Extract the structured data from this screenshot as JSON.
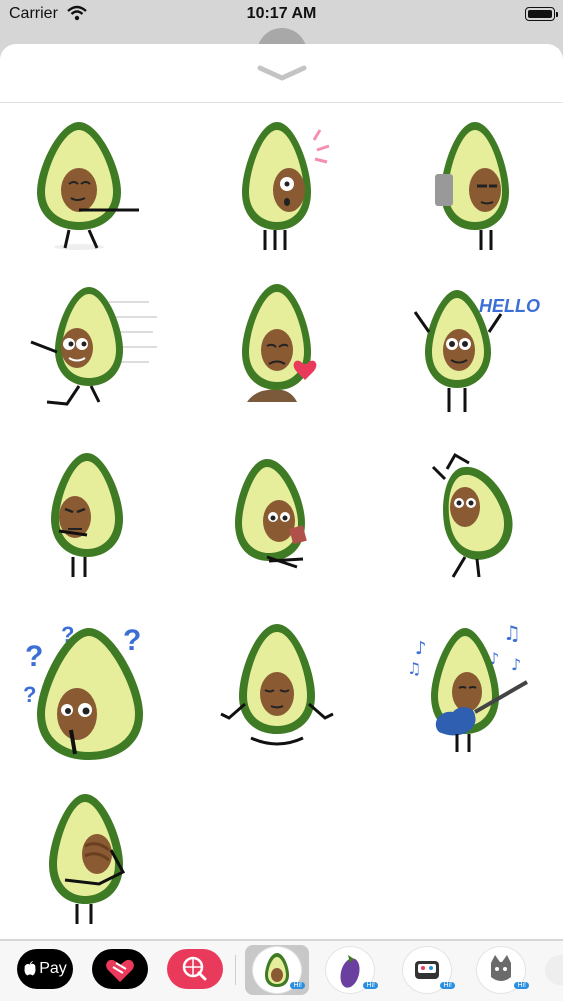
{
  "status_bar": {
    "carrier": "Carrier",
    "time": "10:17 AM",
    "battery_level": 1.0
  },
  "sheet": {
    "collapse_icon": "chevron-down-icon"
  },
  "stickers": [
    {
      "pose": "avocado-pointing"
    },
    {
      "pose": "avocado-surprised"
    },
    {
      "pose": "avocado-phone"
    },
    {
      "pose": "avocado-running"
    },
    {
      "pose": "avocado-broken-heart"
    },
    {
      "pose": "avocado-hello",
      "text": "HELLO"
    },
    {
      "pose": "avocado-angry"
    },
    {
      "pose": "avocado-reading"
    },
    {
      "pose": "avocado-stretching"
    },
    {
      "pose": "avocado-confused"
    },
    {
      "pose": "avocado-meditating"
    },
    {
      "pose": "avocado-guitar"
    },
    {
      "pose": "avocado-shy"
    }
  ],
  "tray": {
    "apple_pay_label": "Pay",
    "apps": [
      "apple-pay-app",
      "heart-app",
      "image-search-app"
    ],
    "packs": [
      {
        "name": "avocado-pack",
        "badge": "Hi!",
        "selected": true
      },
      {
        "name": "eggplant-pack",
        "badge": "Hi!",
        "selected": false
      },
      {
        "name": "robot-pack",
        "badge": "Hi!",
        "selected": false
      },
      {
        "name": "cat-pack",
        "badge": "Hi!",
        "selected": false
      }
    ]
  },
  "colors": {
    "avocado_skin": "#3f7b25",
    "avocado_flesh": "#e6ee9c",
    "pit": "#8a5a33",
    "accent_pink": "#ea3a5b",
    "note_blue": "#3c6fd6"
  }
}
